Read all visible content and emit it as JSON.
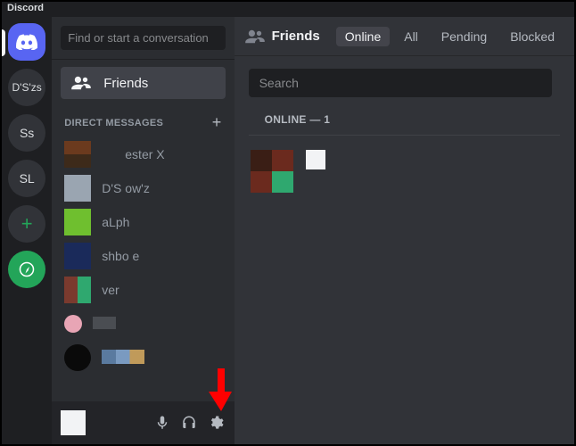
{
  "titlebar": "Discord",
  "servers": {
    "items": [
      {
        "label": "",
        "type": "home"
      },
      {
        "label": "D'S'zs",
        "type": "text"
      },
      {
        "label": "Ss",
        "type": "text"
      },
      {
        "label": "SL",
        "type": "text"
      },
      {
        "label": "+",
        "type": "add"
      },
      {
        "label": "",
        "type": "explore"
      }
    ]
  },
  "channels": {
    "search_placeholder": "Find or start a conversation",
    "friends_label": "Friends",
    "dm_header": "DIRECT MESSAGES",
    "dms": [
      {
        "name": "ester X"
      },
      {
        "name": "D'S    ow'z"
      },
      {
        "name": "aLph"
      },
      {
        "name": "shbo   e"
      },
      {
        "name": "ver"
      },
      {
        "name": ""
      },
      {
        "name": ""
      }
    ]
  },
  "topbar": {
    "title": "Friends",
    "tabs": {
      "online": "Online",
      "all": "All",
      "pending": "Pending",
      "blocked": "Blocked"
    }
  },
  "main": {
    "search_placeholder": "Search",
    "online_header": "ONLINE — 1"
  },
  "colors": {
    "blurple": "#5865f2",
    "green": "#23a559",
    "arrow": "#ff0000"
  }
}
